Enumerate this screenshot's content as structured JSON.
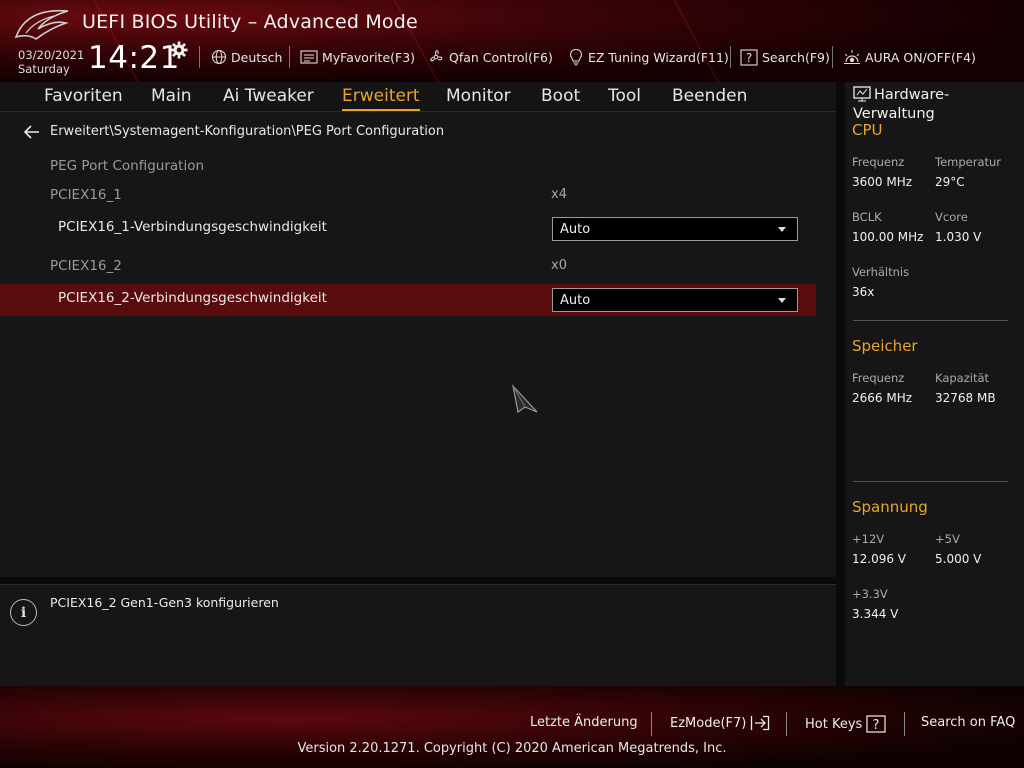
{
  "app": {
    "title": "UEFI BIOS Utility – Advanced Mode",
    "date": "03/20/2021",
    "day": "Saturday",
    "time": "14:21"
  },
  "toolbar": [
    {
      "label": "Deutsch",
      "icon": "globe-icon"
    },
    {
      "label": "MyFavorite(F3)",
      "icon": "favorite-list-icon"
    },
    {
      "label": "Qfan Control(F6)",
      "icon": "fan-icon"
    },
    {
      "label": "EZ Tuning Wizard(F11)",
      "icon": "lightbulb-icon"
    },
    {
      "label": "Search(F9)",
      "icon": "search-question-icon"
    },
    {
      "label": "AURA ON/OFF(F4)",
      "icon": "aura-icon"
    }
  ],
  "nav": {
    "tabs": [
      "Favoriten",
      "Main",
      "Ai Tweaker",
      "Erweitert",
      "Monitor",
      "Boot",
      "Tool",
      "Beenden"
    ],
    "active": "Erweitert"
  },
  "breadcrumb": "Erweitert\\Systemagent-Konfiguration\\PEG Port Configuration",
  "content": {
    "section_header": "PEG Port Configuration",
    "pciex16_1": {
      "label": "PCIEX16_1",
      "value": "x4"
    },
    "pciex16_1_speed": {
      "label": "PCIEX16_1-Verbindungsgeschwindigkeit",
      "value": "Auto"
    },
    "pciex16_2": {
      "label": "PCIEX16_2",
      "value": "x0"
    },
    "pciex16_2_speed": {
      "label": "PCIEX16_2-Verbindungsgeschwindigkeit",
      "value": "Auto"
    }
  },
  "help_text": "PCIEX16_2 Gen1-Gen3 konfigurieren",
  "hardware_monitor": {
    "title": "Hardware-Verwaltung",
    "cpu": {
      "title": "CPU",
      "frequency_label": "Frequenz",
      "frequency": "3600 MHz",
      "temperature_label": "Temperatur",
      "temperature": "29°C",
      "bclk_label": "BCLK",
      "bclk": "100.00 MHz",
      "vcore_label": "Vcore",
      "vcore": "1.030 V",
      "ratio_label": "Verhältnis",
      "ratio": "36x"
    },
    "memory": {
      "title": "Speicher",
      "frequency_label": "Frequenz",
      "frequency": "2666 MHz",
      "capacity_label": "Kapazität",
      "capacity": "32768 MB"
    },
    "voltage": {
      "title": "Spannung",
      "v12_label": "+12V",
      "v12": "12.096 V",
      "v5_label": "+5V",
      "v5": "5.000 V",
      "v33_label": "+3.3V",
      "v33": "3.344 V"
    }
  },
  "footer": {
    "last_change": "Letzte Änderung",
    "ezmode": "EzMode(F7)",
    "hotkeys": "Hot Keys",
    "faq": "Search on FAQ",
    "copyright": "Version 2.20.1271. Copyright (C) 2020 American Megatrends, Inc."
  },
  "colors": {
    "accent": "#e8a526",
    "selected_row": "#5a0b0e",
    "brand_red": "#8a0c12"
  }
}
